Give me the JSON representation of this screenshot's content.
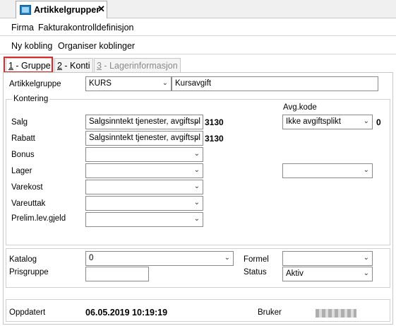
{
  "document_tab": {
    "title": "Artikkelgrupper",
    "close": "✕"
  },
  "menu1": {
    "items": [
      "Firma",
      "Fakturakontrolldefinisjon"
    ]
  },
  "menu2": {
    "items": [
      "Ny kobling",
      "Organiser koblinger"
    ]
  },
  "tabs": [
    {
      "key": "1",
      "label": " - Gruppe"
    },
    {
      "key": "2",
      "label": " - Konti"
    },
    {
      "key": "3",
      "label": " - Lagerinformasjon"
    }
  ],
  "form": {
    "artikkelgruppe": {
      "label": "Artikkelgruppe",
      "code": "KURS",
      "name": "Kursavgift"
    },
    "kontering": {
      "title": "Kontering",
      "avgkode_header": "Avg.kode",
      "rows": [
        {
          "label": "Salg",
          "value": "Salgsinntekt tjenester, avgiftspl",
          "account": "3130",
          "avg_value": "Ikke avgiftsplikt",
          "avg_num": "0"
        },
        {
          "label": "Rabatt",
          "value": "Salgsinntekt tjenester, avgiftspl",
          "account": "3130"
        },
        {
          "label": "Bonus",
          "value": ""
        },
        {
          "label": "Lager",
          "value": "",
          "avg_value": ""
        },
        {
          "label": "Varekost",
          "value": ""
        },
        {
          "label": "Vareuttak",
          "value": ""
        },
        {
          "label": "Prelim.lev.gjeld",
          "value": ""
        }
      ]
    },
    "katalog": {
      "label": "Katalog",
      "value": "0"
    },
    "prisgruppe": {
      "label": "Prisgruppe",
      "value": ""
    },
    "formel": {
      "label": "Formel",
      "value": ""
    },
    "status": {
      "label": "Status",
      "value": "Aktiv"
    },
    "footer": {
      "updated_label": "Oppdatert",
      "updated_value": "06.05.2019 10:19:19",
      "user_label": "Bruker"
    }
  },
  "icons": {
    "dropdown": "chevron-down-icon",
    "doc": "table-icon"
  },
  "colors": {
    "highlight": "#d92b2b"
  }
}
